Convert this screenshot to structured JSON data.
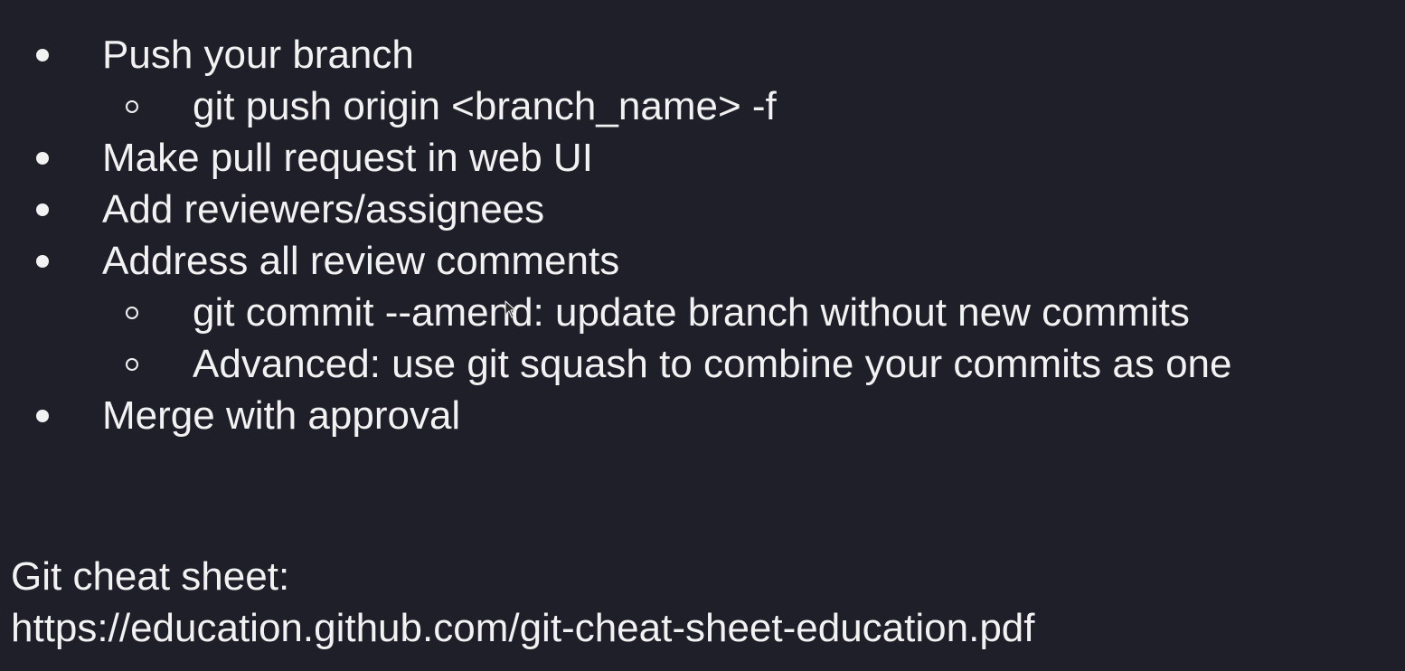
{
  "bullets": [
    {
      "level": 1,
      "text": "Push your branch"
    },
    {
      "level": 2,
      "text": "git push origin <branch_name> -f"
    },
    {
      "level": 1,
      "text": "Make pull request in web UI"
    },
    {
      "level": 1,
      "text": "Add reviewers/assignees"
    },
    {
      "level": 1,
      "text": "Address all review comments"
    },
    {
      "level": 2,
      "text": "git commit --amend: update branch without new commits"
    },
    {
      "level": 2,
      "text": "Advanced: use git squash to combine your commits as one"
    },
    {
      "level": 1,
      "text": "Merge with approval"
    }
  ],
  "footer": {
    "label": "Git cheat sheet:",
    "url": "https://education.github.com/git-cheat-sheet-education.pdf"
  },
  "colors": {
    "background": "#1e1f29",
    "text": "#f2f2f2"
  }
}
